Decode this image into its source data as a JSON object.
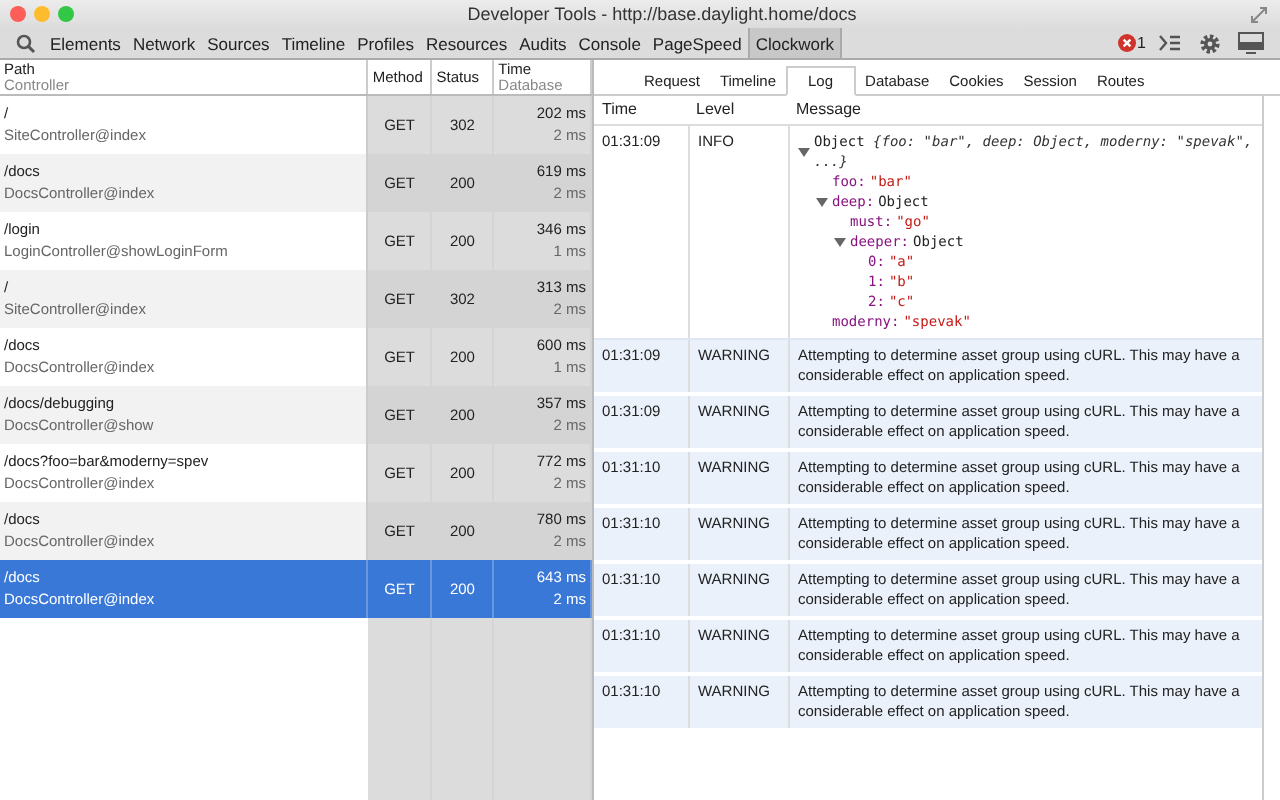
{
  "window": {
    "title": "Developer Tools - http://base.daylight.home/docs"
  },
  "toolbar": {
    "tabs": [
      {
        "label": "Elements",
        "selected": false
      },
      {
        "label": "Network",
        "selected": false
      },
      {
        "label": "Sources",
        "selected": false
      },
      {
        "label": "Timeline",
        "selected": false
      },
      {
        "label": "Profiles",
        "selected": false
      },
      {
        "label": "Resources",
        "selected": false
      },
      {
        "label": "Audits",
        "selected": false
      },
      {
        "label": "Console",
        "selected": false
      },
      {
        "label": "PageSpeed",
        "selected": false
      },
      {
        "label": "Clockwork",
        "selected": true
      }
    ],
    "error_count": "1"
  },
  "requests": {
    "columns": [
      {
        "label": "Path",
        "sublabel": "Controller"
      },
      {
        "label": "Method"
      },
      {
        "label": "Status"
      },
      {
        "label": "Time",
        "sublabel": "Database"
      }
    ],
    "rows": [
      {
        "path": "/",
        "controller": "SiteController@index",
        "method": "GET",
        "status": "302",
        "time": "202 ms",
        "database": "2 ms",
        "selected": false
      },
      {
        "path": "/docs",
        "controller": "DocsController@index",
        "method": "GET",
        "status": "200",
        "time": "619 ms",
        "database": "2 ms",
        "selected": false
      },
      {
        "path": "/login",
        "controller": "LoginController@showLoginForm",
        "method": "GET",
        "status": "200",
        "time": "346 ms",
        "database": "1 ms",
        "selected": false
      },
      {
        "path": "/",
        "controller": "SiteController@index",
        "method": "GET",
        "status": "302",
        "time": "313 ms",
        "database": "2 ms",
        "selected": false
      },
      {
        "path": "/docs",
        "controller": "DocsController@index",
        "method": "GET",
        "status": "200",
        "time": "600 ms",
        "database": "1 ms",
        "selected": false
      },
      {
        "path": "/docs/debugging",
        "controller": "DocsController@show",
        "method": "GET",
        "status": "200",
        "time": "357 ms",
        "database": "2 ms",
        "selected": false
      },
      {
        "path": "/docs?foo=bar&moderny=spev",
        "controller": "DocsController@index",
        "method": "GET",
        "status": "200",
        "time": "772 ms",
        "database": "2 ms",
        "selected": false
      },
      {
        "path": "/docs",
        "controller": "DocsController@index",
        "method": "GET",
        "status": "200",
        "time": "780 ms",
        "database": "2 ms",
        "selected": false
      },
      {
        "path": "/docs",
        "controller": "DocsController@index",
        "method": "GET",
        "status": "200",
        "time": "643 ms",
        "database": "2 ms",
        "selected": true
      }
    ]
  },
  "detail_tabs": [
    {
      "label": "Request",
      "selected": false
    },
    {
      "label": "Timeline",
      "selected": false
    },
    {
      "label": "Log",
      "selected": true
    },
    {
      "label": "Database",
      "selected": false
    },
    {
      "label": "Cookies",
      "selected": false
    },
    {
      "label": "Session",
      "selected": false
    },
    {
      "label": "Routes",
      "selected": false
    }
  ],
  "log": {
    "columns": [
      "Time",
      "Level",
      "Message"
    ],
    "rows": [
      {
        "kind": "object",
        "time": "01:31:09",
        "level": "INFO",
        "object": {
          "label": "Object",
          "summary": "{foo: \"bar\", deep: Object, moderny: \"spevak\", ...}",
          "expanded": true,
          "children": [
            {
              "key": "foo:",
              "value": "\"bar\""
            },
            {
              "key": "deep:",
              "value": "Object",
              "expanded": true,
              "children": [
                {
                  "key": "must:",
                  "value": "\"go\""
                },
                {
                  "key": "deeper:",
                  "value": "Object",
                  "expanded": true,
                  "children": [
                    {
                      "key": "0:",
                      "value": "\"a\""
                    },
                    {
                      "key": "1:",
                      "value": "\"b\""
                    },
                    {
                      "key": "2:",
                      "value": "\"c\""
                    }
                  ]
                }
              ]
            },
            {
              "key": "moderny:",
              "value": "\"spevak\""
            }
          ]
        }
      },
      {
        "kind": "text",
        "time": "01:31:09",
        "level": "WARNING",
        "message": "Attempting to determine asset group using cURL. This may have a considerable effect on application speed."
      },
      {
        "kind": "text",
        "time": "01:31:09",
        "level": "WARNING",
        "message": "Attempting to determine asset group using cURL. This may have a considerable effect on application speed."
      },
      {
        "kind": "text",
        "time": "01:31:10",
        "level": "WARNING",
        "message": "Attempting to determine asset group using cURL. This may have a considerable effect on application speed."
      },
      {
        "kind": "text",
        "time": "01:31:10",
        "level": "WARNING",
        "message": "Attempting to determine asset group using cURL. This may have a considerable effect on application speed."
      },
      {
        "kind": "text",
        "time": "01:31:10",
        "level": "WARNING",
        "message": "Attempting to determine asset group using cURL. This may have a considerable effect on application speed."
      },
      {
        "kind": "text",
        "time": "01:31:10",
        "level": "WARNING",
        "message": "Attempting to determine asset group using cURL. This may have a considerable effect on application speed."
      },
      {
        "kind": "text",
        "time": "01:31:10",
        "level": "WARNING",
        "message": "Attempting to determine asset group using cURL. This may have a considerable effect on application speed."
      }
    ]
  }
}
